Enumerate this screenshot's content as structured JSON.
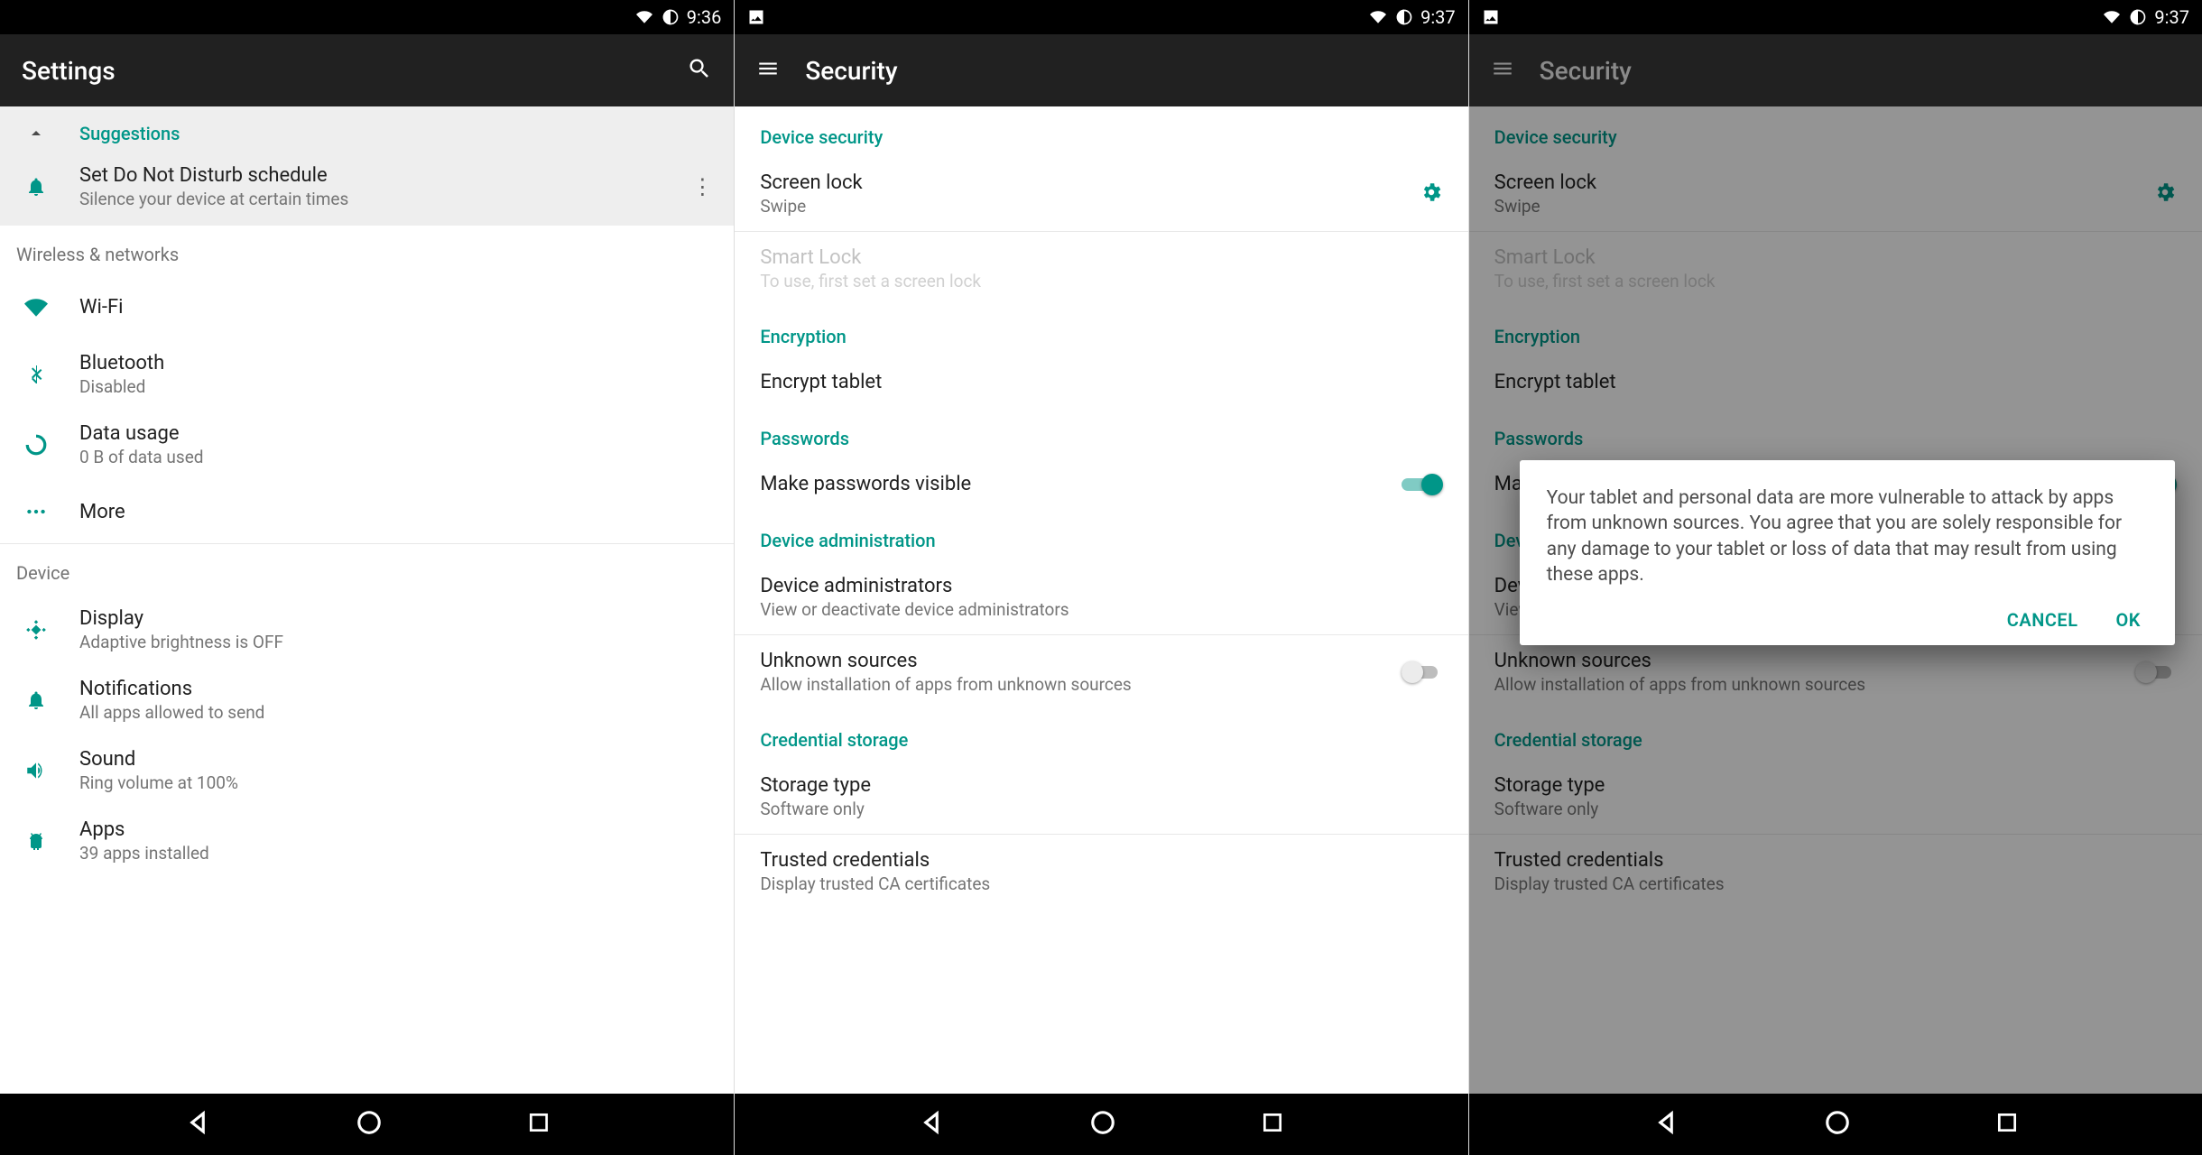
{
  "colors": {
    "accent": "#009688"
  },
  "panel1": {
    "status": {
      "time": "9:36"
    },
    "header": {
      "title": "Settings"
    },
    "suggestions": {
      "header": "Suggestions",
      "item": {
        "title": "Set Do Not Disturb schedule",
        "sub": "Silence your device at certain times"
      }
    },
    "sections": {
      "wireless": {
        "header": "Wireless & networks",
        "wifi": {
          "title": "Wi-Fi",
          "sub": " "
        },
        "bt": {
          "title": "Bluetooth",
          "sub": "Disabled"
        },
        "data": {
          "title": "Data usage",
          "sub": "0 B of data used"
        },
        "more": {
          "title": "More"
        }
      },
      "device": {
        "header": "Device",
        "display": {
          "title": "Display",
          "sub": "Adaptive brightness is OFF"
        },
        "notif": {
          "title": "Notifications",
          "sub": "All apps allowed to send"
        },
        "sound": {
          "title": "Sound",
          "sub": "Ring volume at 100%"
        },
        "apps": {
          "title": "Apps",
          "sub": "39 apps installed"
        }
      }
    }
  },
  "panel2": {
    "status": {
      "time": "9:37"
    },
    "header": {
      "title": "Security"
    },
    "sections": {
      "devSec": {
        "header": "Device security",
        "screenLock": {
          "title": "Screen lock",
          "sub": "Swipe"
        },
        "smartLock": {
          "title": "Smart Lock",
          "sub": "To use, first set a screen lock"
        }
      },
      "encryption": {
        "header": "Encryption",
        "item": {
          "title": "Encrypt tablet"
        }
      },
      "passwords": {
        "header": "Passwords",
        "item": {
          "title": "Make passwords visible"
        }
      },
      "admin": {
        "header": "Device administration",
        "admins": {
          "title": "Device administrators",
          "sub": "View or deactivate device administrators"
        },
        "unknown": {
          "title": "Unknown sources",
          "sub": "Allow installation of apps from unknown sources"
        }
      },
      "cred": {
        "header": "Credential storage",
        "storage": {
          "title": "Storage type",
          "sub": "Software only"
        },
        "trusted": {
          "title": "Trusted credentials",
          "sub": "Display trusted CA certificates"
        }
      }
    }
  },
  "panel3": {
    "status": {
      "time": "9:37"
    },
    "header": {
      "title": "Security"
    },
    "dialog": {
      "message": "Your tablet and personal data are more vulnerable to attack by apps from unknown sources. You agree that you are solely responsible for any damage to your tablet or loss of data that may result from using these apps.",
      "cancel": "CANCEL",
      "ok": "OK"
    }
  }
}
